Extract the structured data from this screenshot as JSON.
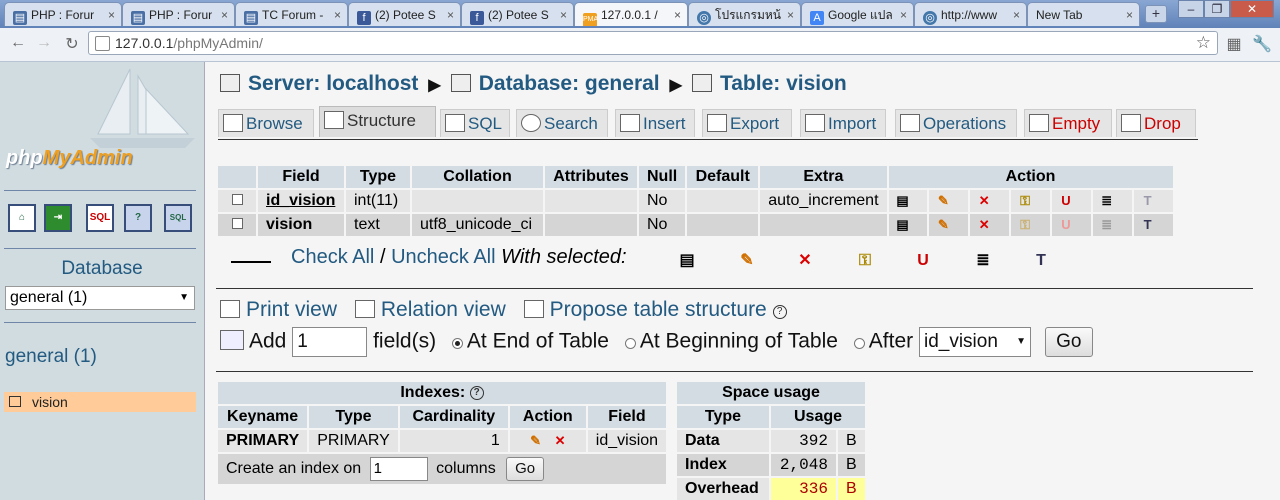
{
  "browser": {
    "tabs": [
      {
        "label": "PHP : Forur",
        "icon": "phpbb-icon",
        "active": false
      },
      {
        "label": "PHP : Forur",
        "icon": "phpbb-icon",
        "active": false
      },
      {
        "label": "TC Forum -",
        "icon": "phpbb-icon",
        "active": false
      },
      {
        "label": "(2) Potee S",
        "icon": "facebook-icon",
        "active": false
      },
      {
        "label": "(2) Potee S",
        "icon": "facebook-icon",
        "active": false
      },
      {
        "label": "127.0.0.1 /",
        "icon": "phpmyadmin-icon",
        "active": true
      },
      {
        "label": "โปรแกรมหน้",
        "icon": "globe-icon",
        "active": false
      },
      {
        "label": "Google แปล",
        "icon": "google-translate-icon",
        "active": false
      },
      {
        "label": "http://www",
        "icon": "globe-icon",
        "active": false
      },
      {
        "label": "New Tab",
        "icon": "",
        "active": false
      }
    ],
    "url_host": "127.0.0.1",
    "url_path": "/phpMyAdmin/"
  },
  "sidebar": {
    "logo_php": "php",
    "logo_my": "MyAdmin",
    "database_label": "Database",
    "database_select": "general (1)",
    "database_link": "general (1)",
    "tables": [
      "vision"
    ]
  },
  "breadcrumb": {
    "server": "Server: localhost",
    "database": "Database: general",
    "table": "Table: vision"
  },
  "tabs": [
    "Browse",
    "Structure",
    "SQL",
    "Search",
    "Insert",
    "Export",
    "Import",
    "Operations",
    "Empty",
    "Drop"
  ],
  "structure": {
    "headers": [
      "Field",
      "Type",
      "Collation",
      "Attributes",
      "Null",
      "Default",
      "Extra",
      "Action"
    ],
    "rows": [
      {
        "field": "id_vision",
        "type": "int(11)",
        "collation": "",
        "attributes": "",
        "null": "No",
        "default": "",
        "extra": "auto_increment"
      },
      {
        "field": "vision",
        "type": "text",
        "collation": "utf8_unicode_ci",
        "attributes": "",
        "null": "No",
        "default": "",
        "extra": ""
      }
    ]
  },
  "bulk": {
    "check_all": "Check All",
    "separator": "/",
    "uncheck_all": "Uncheck All",
    "with_selected": "With selected:"
  },
  "links": {
    "print_view": "Print view",
    "relation_view": "Relation view",
    "propose": "Propose table structure"
  },
  "add_field": {
    "label": "Add",
    "count": "1",
    "fields": "field(s)",
    "at_end": "At End of Table",
    "at_beginning": "At Beginning of Table",
    "after": "After",
    "after_select": "id_vision",
    "go": "Go"
  },
  "indexes": {
    "title": "Indexes:",
    "headers": [
      "Keyname",
      "Type",
      "Cardinality",
      "Action",
      "Field"
    ],
    "row": {
      "keyname": "PRIMARY",
      "type": "PRIMARY",
      "cardinality": "1",
      "field": "id_vision"
    },
    "create_prefix": "Create an index on",
    "create_count": "1",
    "create_suffix": "columns",
    "go": "Go"
  },
  "space": {
    "title": "Space usage",
    "headers": [
      "Type",
      "Usage"
    ],
    "rows": [
      {
        "type": "Data",
        "usage": "392",
        "unit": "B"
      },
      {
        "type": "Index",
        "usage": "2,048",
        "unit": "B"
      },
      {
        "type": "Overhead",
        "usage": "336",
        "unit": "B"
      }
    ]
  },
  "colors": {
    "link": "#235a81",
    "header_bg": "#d3dce3",
    "highlight_row": "#ffcc99",
    "overhead_bg": "#ffff99",
    "overhead_text": "#aa0000"
  }
}
